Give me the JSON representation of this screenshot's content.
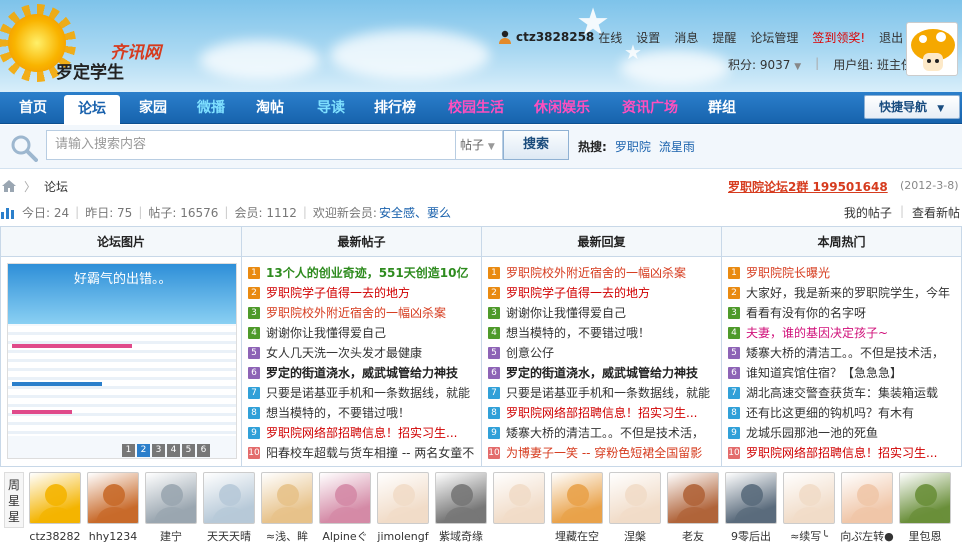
{
  "header": {
    "logo_line1": "齐讯网",
    "logo_line2": "罗定学生",
    "username": "ctz3828258",
    "online_status": "在线",
    "links": [
      "设置",
      "消息",
      "提醒",
      "论坛管理"
    ],
    "signin": "签到领奖!",
    "logout": "退出",
    "points": "积分: 9037",
    "usergroup": "用户组: 班主任"
  },
  "nav": {
    "items": [
      {
        "label": "首页",
        "color": "#ffffff"
      },
      {
        "label": "论坛",
        "color": "#1a62ad"
      },
      {
        "label": "家园",
        "color": "#ffffff"
      },
      {
        "label": "微播",
        "color": "#7fe0ff"
      },
      {
        "label": "淘帖",
        "color": "#ffffff"
      },
      {
        "label": "导读",
        "color": "#7fe0ff"
      },
      {
        "label": "排行榜",
        "color": "#ffffff"
      },
      {
        "label": "校园生活",
        "color": "#ff4fbf"
      },
      {
        "label": "休闲娱乐",
        "color": "#ff4fbf"
      },
      {
        "label": "资讯广场",
        "color": "#ff4fbf"
      },
      {
        "label": "群组",
        "color": "#ffffff"
      }
    ],
    "quick_nav": "快捷导航"
  },
  "search": {
    "placeholder": "请输入搜索内容",
    "type": "帖子",
    "button": "搜索",
    "hot_label": "热搜:",
    "hot_words": [
      "罗职院",
      "流星雨"
    ]
  },
  "breadcrumb": {
    "current": "论坛"
  },
  "announcement": {
    "title": "罗职院论坛2群 199501648",
    "date": "(2012-3-8)"
  },
  "stats": {
    "today": "今日: 24",
    "yesterday": "昨日: 75",
    "posts": "帖子: 16576",
    "members": "会员: 1112",
    "welcome": "欢迎新会员:",
    "new_member": "安全感、要么",
    "my_posts": "我的帖子",
    "new_posts": "查看新帖"
  },
  "portal": {
    "headers": [
      "论坛图片",
      "最新帖子",
      "最新回复",
      "本周热门"
    ],
    "pic_caption": "好霸气的出错。。",
    "pic_pages": [
      "1",
      "2",
      "3",
      "4",
      "5",
      "6"
    ],
    "latest_posts": [
      {
        "n": "1",
        "title": "13个人的创业奇迹，551天创造10亿",
        "color": "#2e8b1e",
        "bold": true
      },
      {
        "n": "2",
        "title": "罗职院学子值得一去的地方",
        "color": "#d00000",
        "bold": false
      },
      {
        "n": "3",
        "title": "罗职院校外附近宿舍的一幅凶杀案",
        "color": "#d63b1e",
        "bold": false
      },
      {
        "n": "4",
        "title": "谢谢你让我懂得爱自己",
        "color": "#333333",
        "bold": false
      },
      {
        "n": "5",
        "title": "女人几天洗一次头发才最健康",
        "color": "#333333",
        "bold": false
      },
      {
        "n": "6",
        "title": "罗定的街道浇水，威武城管给力神技",
        "color": "#222222",
        "bold": true
      },
      {
        "n": "7",
        "title": "只要是诺基亚手机和一条数据线，就能",
        "color": "#333333",
        "bold": false
      },
      {
        "n": "8",
        "title": "想当模特的，不要错过哦！",
        "color": "#333333",
        "bold": false
      },
      {
        "n": "9",
        "title": "罗职院网络部招聘信息！招实习生...",
        "color": "#d00000",
        "bold": false
      },
      {
        "n": "10",
        "title": "阳春校车超载与货车相撞 -- 两名女童不",
        "color": "#333333",
        "bold": false
      }
    ],
    "latest_replies": [
      {
        "n": "1",
        "title": "罗职院校外附近宿舍的一幅凶杀案",
        "color": "#d63b1e",
        "bold": false
      },
      {
        "n": "2",
        "title": "罗职院学子值得一去的地方",
        "color": "#d00000",
        "bold": false
      },
      {
        "n": "3",
        "title": "谢谢你让我懂得爱自己",
        "color": "#333333",
        "bold": false
      },
      {
        "n": "4",
        "title": "想当模特的，不要错过哦！",
        "color": "#333333",
        "bold": false
      },
      {
        "n": "5",
        "title": "创意公仔",
        "color": "#333333",
        "bold": false
      },
      {
        "n": "6",
        "title": "罗定的街道浇水，威武城管给力神技",
        "color": "#222222",
        "bold": true
      },
      {
        "n": "7",
        "title": "只要是诺基亚手机和一条数据线，就能",
        "color": "#333333",
        "bold": false
      },
      {
        "n": "8",
        "title": "罗职院网络部招聘信息！招实习生...",
        "color": "#d00000",
        "bold": false
      },
      {
        "n": "9",
        "title": "矮寨大桥的清洁工。。不但是技术活，",
        "color": "#333333",
        "bold": false
      },
      {
        "n": "10",
        "title": "为博妻子一笑 -- 穿粉色短裙全国留影",
        "color": "#d63b1e",
        "bold": false
      }
    ],
    "weekly_hot": [
      {
        "n": "1",
        "title": "罗职院院长曝光",
        "color": "#d63b1e",
        "bold": false
      },
      {
        "n": "2",
        "title": "大家好，我是新来的罗职院学生，今年",
        "color": "#333333",
        "bold": false
      },
      {
        "n": "3",
        "title": "看看有没有你的名字呀",
        "color": "#333333",
        "bold": false
      },
      {
        "n": "4",
        "title": "夫妻，谁的基因决定孩子~",
        "color": "#d0107a",
        "bold": false
      },
      {
        "n": "5",
        "title": "矮寨大桥的清洁工。。不但是技术活，",
        "color": "#333333",
        "bold": false
      },
      {
        "n": "6",
        "title": "谁知道宾馆住宿？【急急急】",
        "color": "#333333",
        "bold": false
      },
      {
        "n": "7",
        "title": "湖北高速交警查获货车：集装箱运载",
        "color": "#333333",
        "bold": false
      },
      {
        "n": "8",
        "title": "还有比这更细的钩机吗？有木有",
        "color": "#333333",
        "bold": false
      },
      {
        "n": "9",
        "title": "龙城乐园那池一池的死鱼",
        "color": "#333333",
        "bold": false
      },
      {
        "n": "10",
        "title": "罗职院网络部招聘信息！招实习生...",
        "color": "#d00000",
        "bold": false
      }
    ]
  },
  "star_users": {
    "label": "周星星",
    "users": [
      {
        "name": "ctz38282",
        "bg": "#f4b400"
      },
      {
        "name": "hhy1234",
        "bg": "#c86a2a"
      },
      {
        "name": "建宁",
        "bg": "#9aa6b0"
      },
      {
        "name": "天天天晴",
        "bg": "#b7c9d8"
      },
      {
        "name": "≈浅、眸",
        "bg": "#e7c28a"
      },
      {
        "name": "Alpineぐ",
        "bg": "#d48aa6"
      },
      {
        "name": "jimolengf",
        "bg": "#f1dcc8"
      },
      {
        "name": "紫域奇缘",
        "bg": "#777777"
      },
      {
        "name": "",
        "bg": "#f1dcc8"
      },
      {
        "name": "埋藏在空",
        "bg": "#e9a24a"
      },
      {
        "name": "涅槃",
        "bg": "#f1dcc8"
      },
      {
        "name": "老友",
        "bg": "#b0643a"
      },
      {
        "name": "9零后出",
        "bg": "#5a6b7c"
      },
      {
        "name": "≈续写╰",
        "bg": "#f1dcc8"
      },
      {
        "name": "向ぷ左转●",
        "bg": "#f0c6a8"
      },
      {
        "name": "里包恩",
        "bg": "#6a8f3a"
      }
    ]
  }
}
